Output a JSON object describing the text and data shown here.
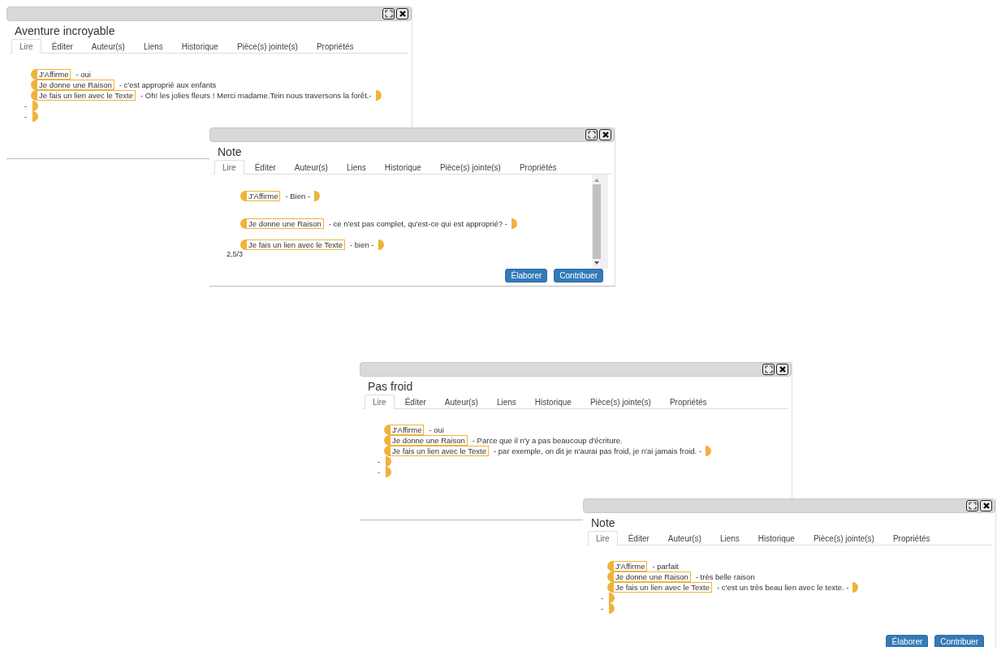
{
  "windows": [
    {
      "title": "Aventure incroyable",
      "tabs": [
        {
          "label": "Lire",
          "selected": true
        },
        {
          "label": "Éditer",
          "selected": false
        },
        {
          "label": "Auteur(s)",
          "selected": false
        },
        {
          "label": "Liens",
          "selected": false
        },
        {
          "label": "Historique",
          "selected": false
        },
        {
          "label": "Pièce(s) jointe(s)",
          "selected": false
        },
        {
          "label": "Propriétés",
          "selected": false
        }
      ],
      "lines": [
        {
          "kind": "move",
          "label": "J'Affirme",
          "text": "- oui",
          "closed": false
        },
        {
          "kind": "move",
          "label": "Je donne une Raison",
          "text": "- c'est approprié aux enfants",
          "closed": false
        },
        {
          "kind": "move",
          "label": "Je fais un lien avec le Texte",
          "text": "- Oh! les jolies fleurs ! Merci madame.Tein nous traversons la forêt.-",
          "closed": true
        },
        {
          "kind": "empty",
          "text": "-",
          "closed": true
        },
        {
          "kind": "empty",
          "text": "-",
          "closed": true
        }
      ]
    },
    {
      "title": "Note",
      "tabs": [
        {
          "label": "Lire",
          "selected": true
        },
        {
          "label": "Éditer",
          "selected": false
        },
        {
          "label": "Auteur(s)",
          "selected": false
        },
        {
          "label": "Liens",
          "selected": false
        },
        {
          "label": "Historique",
          "selected": false
        },
        {
          "label": "Pièce(s) jointe(s)",
          "selected": false
        },
        {
          "label": "Propriétés",
          "selected": false
        }
      ],
      "lines": [
        {
          "kind": "move",
          "label": "J'Affirme",
          "text": "- Bien -",
          "closed": true
        },
        {
          "kind": "move",
          "label": "Je donne une Raison",
          "text": "- ce n'est pas complet, qu'est-ce qui est approprié? -",
          "closed": true
        },
        {
          "kind": "move",
          "label": "Je fais un lien avec le Texte",
          "text": "- bien -",
          "closed": true
        }
      ],
      "score": "2,5/3",
      "buttons": [
        "Élaborer",
        "Contribuer"
      ]
    },
    {
      "title": "Pas froid",
      "tabs": [
        {
          "label": "Lire",
          "selected": true
        },
        {
          "label": "Éditer",
          "selected": false
        },
        {
          "label": "Auteur(s)",
          "selected": false
        },
        {
          "label": "Liens",
          "selected": false
        },
        {
          "label": "Historique",
          "selected": false
        },
        {
          "label": "Pièce(s) jointe(s)",
          "selected": false
        },
        {
          "label": "Propriétés",
          "selected": false
        }
      ],
      "lines": [
        {
          "kind": "move",
          "label": "J'Affirme",
          "text": "- oui",
          "closed": false
        },
        {
          "kind": "move",
          "label": "Je donne une Raison",
          "text": "- Parce que il n'y a pas beaucoup d'écriture.",
          "closed": false
        },
        {
          "kind": "move",
          "label": "Je fais un lien avec le Texte",
          "text": "- par exemple, on dit je n'aurai pas froid, je n'ai jamais froid. -",
          "closed": true
        },
        {
          "kind": "empty",
          "text": "-",
          "closed": true
        },
        {
          "kind": "empty",
          "text": "-",
          "closed": true
        }
      ]
    },
    {
      "title": "Note",
      "tabs": [
        {
          "label": "Lire",
          "selected": true
        },
        {
          "label": "Éditer",
          "selected": false
        },
        {
          "label": "Auteur(s)",
          "selected": false
        },
        {
          "label": "Liens",
          "selected": false
        },
        {
          "label": "Historique",
          "selected": false
        },
        {
          "label": "Pièce(s) jointe(s)",
          "selected": false
        },
        {
          "label": "Propriétés",
          "selected": false
        }
      ],
      "lines": [
        {
          "kind": "move",
          "label": "J'Affirme",
          "text": "- parfait",
          "closed": false
        },
        {
          "kind": "move",
          "label": "Je donne une Raison",
          "text": "- très belle raison",
          "closed": false
        },
        {
          "kind": "move",
          "label": "Je fais un lien avec le Texte",
          "text": "- c'est un très beau lien avec le texte. -",
          "closed": true
        },
        {
          "kind": "empty",
          "text": "-",
          "closed": true
        },
        {
          "kind": "empty",
          "text": "-",
          "closed": true
        }
      ],
      "buttons": [
        "Élaborer",
        "Contribuer"
      ]
    }
  ]
}
